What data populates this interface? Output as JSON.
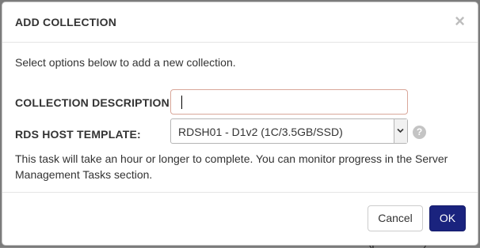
{
  "background": {
    "partial_text": "Consumed credits (past 24hrs): 0.01"
  },
  "modal": {
    "title": "ADD COLLECTION",
    "close_glyph": "×",
    "intro": "Select options below to add a new collection.",
    "collection_description": {
      "label": "COLLECTION DESCRIPTION:",
      "value": "",
      "placeholder": ""
    },
    "rds_host_template": {
      "label": "RDS HOST TEMPLATE:",
      "selected": "RDSH01 - D1v2 (1C/3.5GB/SSD)"
    },
    "help_glyph": "?",
    "note": "This task will take an hour or longer to complete. You can monitor progress in the Server Management Tasks section.",
    "buttons": {
      "cancel": "Cancel",
      "ok": "OK"
    }
  },
  "colors": {
    "ok_button": "#1a237e",
    "input_border_focus": "#d9a79a",
    "help_icon": "#c4c4c4"
  }
}
